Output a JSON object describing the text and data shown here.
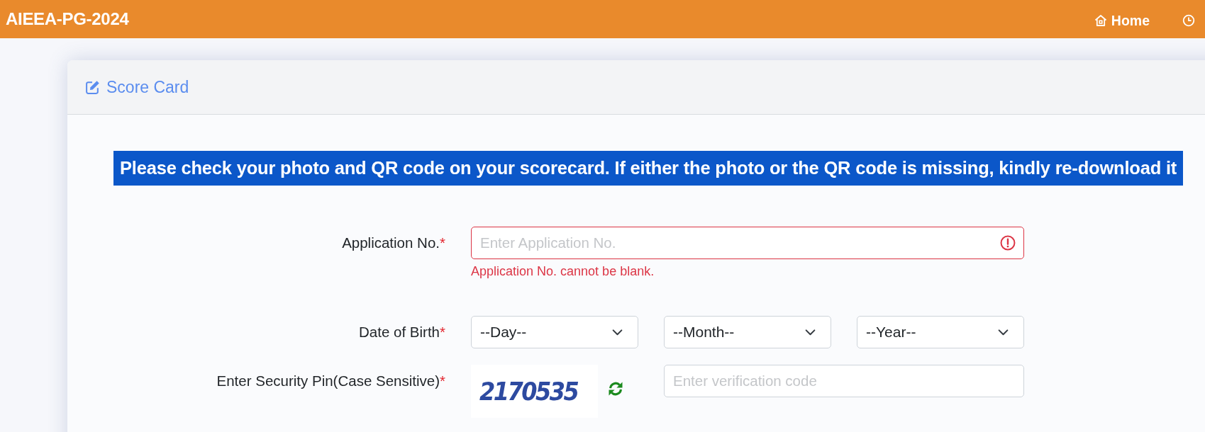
{
  "top_bar": {
    "title": "AIEEA-PG-2024",
    "nav": [
      {
        "kind": "home",
        "label": "Home"
      },
      {
        "kind": "clock"
      }
    ]
  },
  "card": {
    "title": "Score Card",
    "notice": "Please check your photo and QR code on your scorecard. If either the photo or the QR code is missing, kindly re-download it",
    "fields": [
      {
        "kind": "text",
        "label": "Application No.",
        "required_mark": "*",
        "placeholder": "Enter Application No.",
        "invalid": true,
        "error": "Application No. cannot be blank."
      },
      {
        "kind": "date",
        "label": "Date of Birth",
        "required_mark": "*",
        "selects": [
          {
            "value": "--Day--"
          },
          {
            "value": "--Month--"
          },
          {
            "value": "--Year--"
          }
        ]
      },
      {
        "kind": "captcha",
        "label": "Enter Security Pin(Case Sensitive)",
        "required_mark": "*",
        "captcha": "2170535",
        "placeholder": "Enter verification code"
      }
    ]
  }
}
